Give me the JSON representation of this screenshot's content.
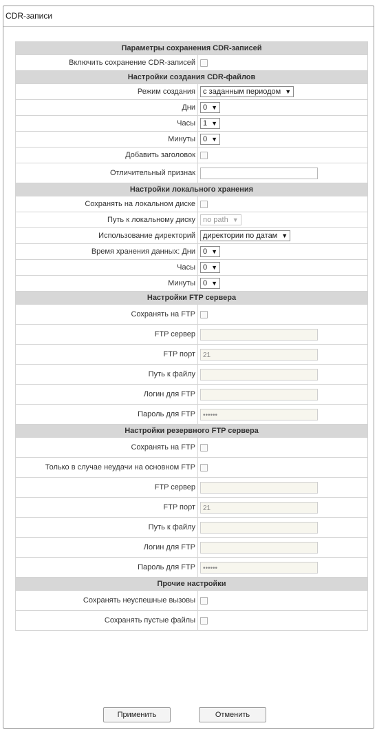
{
  "window_title": "CDR-записи",
  "sections": {
    "save_params": "Параметры сохранения CDR-записей",
    "file_settings": "Настройки создания CDR-файлов",
    "local_storage": "Настройки локального хранения",
    "ftp_server": "Настройки FTP сервера",
    "backup_ftp_server": "Настройки резервного FTP сервера",
    "other": "Прочие настройки"
  },
  "labels": {
    "enable_cdr": "Включить сохранение CDR-записей",
    "mode": "Режим создания",
    "days": "Дни",
    "hours": "Часы",
    "minutes": "Минуты",
    "add_header": "Добавить заголовок",
    "sign": "Отличительный признак",
    "save_local": "Сохранять на локальном диске",
    "local_path": "Путь к локальному диску",
    "dir_usage": "Использование директорий",
    "retention_days": "Время хранения данных: Дни",
    "save_ftp": "Сохранять на FTP",
    "ftp_server": "FTP сервер",
    "ftp_port": "FTP порт",
    "file_path": "Путь к файлу",
    "ftp_login": "Логин для FTP",
    "ftp_password": "Пароль для FTP",
    "only_on_fail": "Только в случае неудачи на основном FTP",
    "save_failed_calls": "Сохранять неуспешные вызовы",
    "save_empty_files": "Сохранять пустые файлы"
  },
  "values": {
    "mode": "с заданным периодом",
    "days": "0",
    "hours": "1",
    "minutes": "0",
    "sign": "",
    "local_path": "no path",
    "dir_usage": "директории по датам",
    "retention_days": "0",
    "retention_hours": "0",
    "retention_minutes": "0",
    "ftp_server": "",
    "ftp_port": "21",
    "ftp_file_path": "",
    "ftp_login": "",
    "ftp_password": "••••••",
    "backup_ftp_server": "",
    "backup_ftp_port": "21",
    "backup_file_path": "",
    "backup_login": "",
    "backup_password": "••••••"
  },
  "checkboxes": {
    "enable_cdr": false,
    "add_header": false,
    "save_local": false,
    "save_ftp": false,
    "backup_save_ftp": false,
    "only_on_fail": false,
    "save_failed_calls": false,
    "save_empty_files": false
  },
  "buttons": {
    "apply": "Применить",
    "cancel": "Отменить"
  },
  "dropdown_arrow": "▼"
}
